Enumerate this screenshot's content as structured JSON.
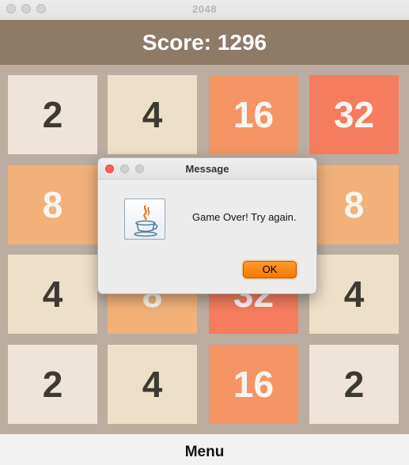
{
  "window": {
    "title": "2048"
  },
  "header": {
    "score_label": "Score: 1296"
  },
  "board": {
    "tiles": [
      {
        "value": "2",
        "bg": "#eee4da",
        "fg": "#3c3a32"
      },
      {
        "value": "4",
        "bg": "#ede0c8",
        "fg": "#3c3a32"
      },
      {
        "value": "16",
        "bg": "#f59563",
        "fg": "#f9f6f2"
      },
      {
        "value": "32",
        "bg": "#f67c5f",
        "fg": "#f9f6f2"
      },
      {
        "value": "8",
        "bg": "#f2b179",
        "fg": "#f9f6f2"
      },
      {
        "value": "",
        "bg": "#ede0c8",
        "fg": "#3c3a32"
      },
      {
        "value": "",
        "bg": "#f59563",
        "fg": "#f9f6f2"
      },
      {
        "value": "8",
        "bg": "#f2b179",
        "fg": "#f9f6f2"
      },
      {
        "value": "4",
        "bg": "#ede0c8",
        "fg": "#3c3a32"
      },
      {
        "value": "8",
        "bg": "#f2b179",
        "fg": "#f9f6f2"
      },
      {
        "value": "32",
        "bg": "#f67c5f",
        "fg": "#f9f6f2"
      },
      {
        "value": "4",
        "bg": "#ede0c8",
        "fg": "#3c3a32"
      },
      {
        "value": "2",
        "bg": "#eee4da",
        "fg": "#3c3a32"
      },
      {
        "value": "4",
        "bg": "#ede0c8",
        "fg": "#3c3a32"
      },
      {
        "value": "16",
        "bg": "#f59563",
        "fg": "#f9f6f2"
      },
      {
        "value": "2",
        "bg": "#eee4da",
        "fg": "#3c3a32"
      }
    ]
  },
  "menu": {
    "label": "Menu"
  },
  "dialog": {
    "title": "Message",
    "message": "Game Over! Try again.",
    "icon": "java-icon",
    "ok_label": "OK"
  },
  "colors": {
    "header_bg": "#8f7a66",
    "board_bg": "#bbada0",
    "ok_button": "#f47a00"
  }
}
